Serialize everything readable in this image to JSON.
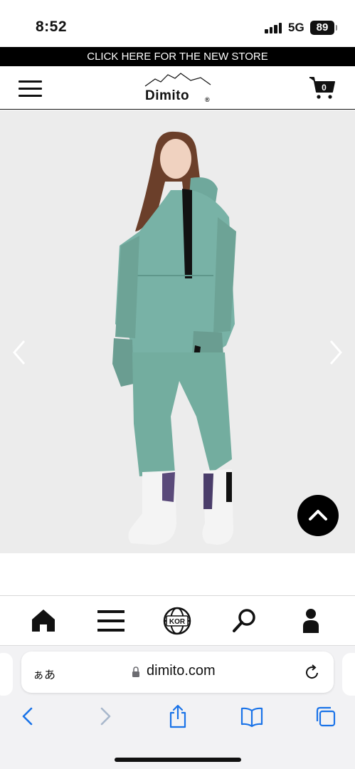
{
  "status_bar": {
    "time": "8:52",
    "network": "5G",
    "battery": "89"
  },
  "promo_banner": {
    "text": "CLICK HERE FOR THE NEW STORE"
  },
  "header": {
    "brand": "Dimito",
    "registered_mark": "®",
    "cart_count": "0"
  },
  "hero": {
    "image": "model wearing mint green snow anorak and pants with white snow boots",
    "prev_icon": "chevron-left-icon",
    "next_icon": "chevron-right-icon",
    "scroll_top_icon": "chevron-up-icon"
  },
  "bottom_nav": {
    "items": [
      {
        "icon": "home-icon"
      },
      {
        "icon": "menu-icon"
      },
      {
        "icon": "globe-icon",
        "label": "KOR"
      },
      {
        "icon": "search-icon"
      },
      {
        "icon": "user-icon"
      }
    ]
  },
  "browser": {
    "text_size_label": "ぁあ",
    "url": "dimito.com",
    "toolbar": [
      "back-icon",
      "forward-icon",
      "share-icon",
      "bookmarks-icon",
      "tabs-icon"
    ],
    "accent_color": "#1a73e8"
  }
}
